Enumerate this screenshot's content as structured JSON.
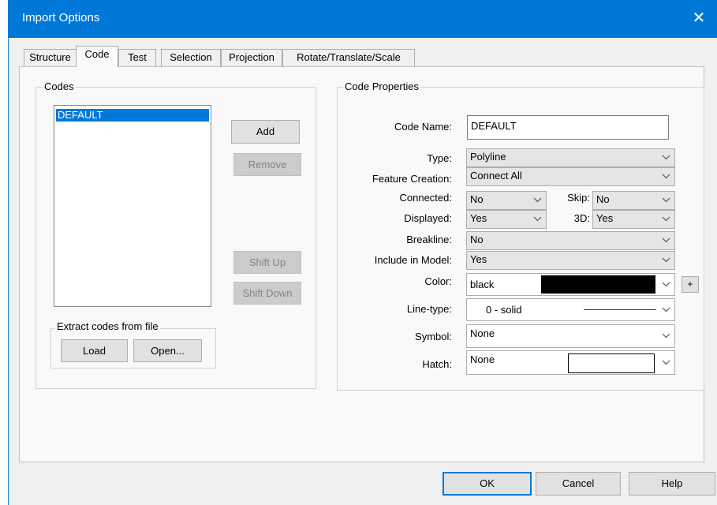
{
  "window": {
    "title": "Import Options"
  },
  "tabs": [
    "Structure",
    "Code",
    "Test",
    "Selection",
    "Projection",
    "Rotate/Translate/Scale"
  ],
  "codes": {
    "group_label": "Codes",
    "items": [
      "DEFAULT"
    ],
    "buttons": {
      "add": "Add",
      "remove": "Remove",
      "shift_up": "Shift Up",
      "shift_down": "Shift Down"
    },
    "extract": {
      "label": "Extract codes from file",
      "load": "Load",
      "open": "Open..."
    }
  },
  "props": {
    "group_label": "Code Properties",
    "code_name": {
      "label": "Code Name:",
      "value": "DEFAULT"
    },
    "type": {
      "label": "Type:",
      "value": "Polyline"
    },
    "feature_creation": {
      "label": "Feature Creation:",
      "value": "Connect All"
    },
    "connected": {
      "label": "Connected:",
      "value": "No"
    },
    "skip": {
      "label": "Skip:",
      "value": "No"
    },
    "displayed": {
      "label": "Displayed:",
      "value": "Yes"
    },
    "three_d": {
      "label": "3D:",
      "value": "Yes"
    },
    "breakline": {
      "label": "Breakline:",
      "value": "No"
    },
    "include_in_model": {
      "label": "Include in Model:",
      "value": "Yes"
    },
    "color": {
      "label": "Color:",
      "value": "black",
      "swatch": "#000000",
      "plus": "+"
    },
    "line_type": {
      "label": "Line-type:",
      "value": "0 - solid"
    },
    "symbol": {
      "label": "Symbol:",
      "value": "None"
    },
    "hatch": {
      "label": "Hatch:",
      "value": "None"
    }
  },
  "footer": {
    "ok": "OK",
    "cancel": "Cancel",
    "help": "Help"
  },
  "colors": {
    "title_bar": "#0078d7",
    "selection": "#0078d7"
  },
  "icons": {
    "close": "close-icon",
    "dropdown": "chevron-down-icon"
  }
}
